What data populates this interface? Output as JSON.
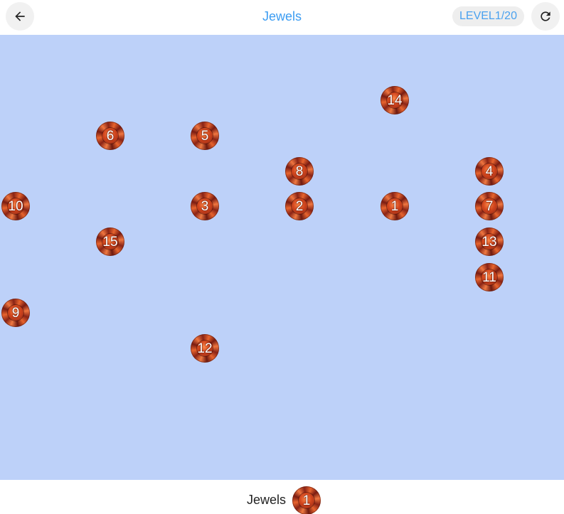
{
  "header": {
    "title": "Jewels",
    "level_label": "LEVEL1/20",
    "back_icon": "arrow-left-icon",
    "reload_icon": "reload-icon"
  },
  "colors": {
    "title": "#3b9cf2",
    "board_background": "#bdd1f9",
    "level_badge_text": "#4aa1ef"
  },
  "board": {
    "jewels": [
      "14",
      "6",
      "5",
      "8",
      "4",
      "10",
      "3",
      "2",
      "1",
      "7",
      "15",
      "13",
      "11",
      "9",
      "12"
    ]
  },
  "footer": {
    "label": "Jewels",
    "next_jewel": "1"
  }
}
